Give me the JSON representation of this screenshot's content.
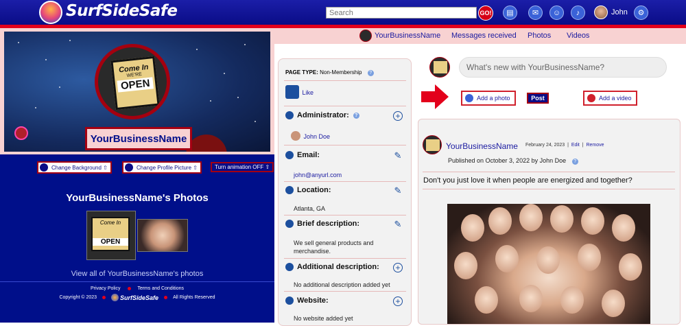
{
  "header": {
    "logo_text": "SurfSideSafe",
    "search_placeholder": "Search",
    "go_label": "GO!",
    "user_name": "John",
    "icons": [
      "profile-card-icon",
      "mail-icon",
      "friends-icon",
      "notifications-bell-icon",
      "settings-gear-icon"
    ]
  },
  "cover": {
    "business_name": "YourBusinessName",
    "sign_line1": "Come In",
    "sign_line2": "WE'RE",
    "sign_line3": "OPEN"
  },
  "left_buttons": {
    "change_background": "Change Background ⇧",
    "change_profile_picture": "Change Profile Picture ⇧",
    "animation": "Turn animation OFF ⇧"
  },
  "photos": {
    "title": "YourBusinessName's Photos",
    "view_all": "View all of YourBusinessName's photos"
  },
  "footer": {
    "privacy": "Privacy Policy",
    "terms": "Terms and Conditions",
    "copyright": "Copyright © 2023",
    "brand": "SurfSideSafe",
    "rights": "All Rights Reserved"
  },
  "nav": {
    "items": [
      "YourBusinessName",
      "Messages received",
      "Photos",
      "Videos"
    ]
  },
  "info": {
    "page_type_label": "PAGE TYPE:",
    "page_type_value": "Non-Membership",
    "like_label": "Like",
    "administrator_title": "Administrator:",
    "administrator_name": "John Doe",
    "email_title": "Email:",
    "email_value": "john@anyurl.com",
    "location_title": "Location:",
    "location_value": "Atlanta, GA",
    "brief_title": "Brief description:",
    "brief_value": "We sell general products and merchandise.",
    "additional_title": "Additional description:",
    "additional_value": "No additional description added yet",
    "website_title": "Website:",
    "website_value": "No website added yet"
  },
  "composer": {
    "placeholder": "What's new with YourBusinessName?",
    "add_photo": "Add a photo",
    "post": "Post",
    "add_video": "Add a video"
  },
  "post": {
    "author": "YourBusinessName",
    "date": "February 24, 2023",
    "edit": "Edit",
    "remove": "Remove",
    "published": "Published on October 3, 2022 by John Doe",
    "text": "Don't you just love it when people are energized and together?"
  },
  "colors": {
    "header_blue": "#0a0c86",
    "accent_red": "#e3001b",
    "pink_bg": "#f8d2d2",
    "left_bg": "#000f8a"
  }
}
